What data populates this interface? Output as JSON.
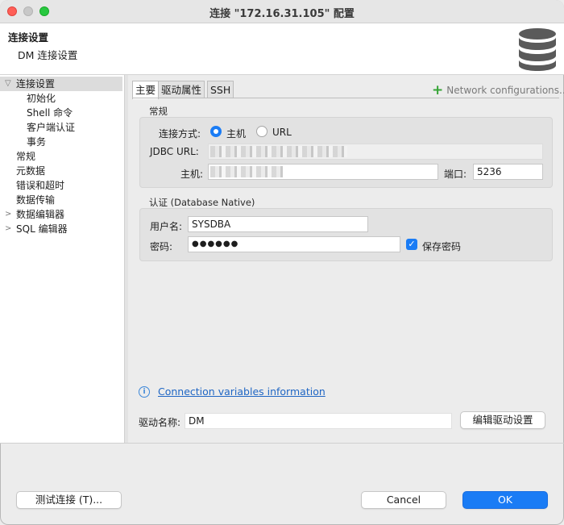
{
  "window": {
    "title": "连接 \"172.16.31.105\" 配置"
  },
  "header": {
    "title": "连接设置",
    "subtitle": "DM 连接设置",
    "icon": "database-icon"
  },
  "nav": {
    "items": [
      {
        "label": "连接设置",
        "selected": true,
        "expanded": true
      },
      {
        "label": "初始化"
      },
      {
        "label": "Shell 命令"
      },
      {
        "label": "客户端认证"
      },
      {
        "label": "事务"
      },
      {
        "label": "常规"
      },
      {
        "label": "元数据"
      },
      {
        "label": "错误和超时"
      },
      {
        "label": "数据传输"
      },
      {
        "label": "数据编辑器",
        "collapsed": true
      },
      {
        "label": "SQL 编辑器",
        "collapsed": true
      }
    ]
  },
  "tabs": [
    {
      "label": "主要",
      "active": true
    },
    {
      "label": "驱动属性"
    },
    {
      "label": "SSH"
    }
  ],
  "network": {
    "label": "Network configurations..."
  },
  "general": {
    "title": "常规",
    "connect_by_label": "连接方式:",
    "option_host": "主机",
    "option_url": "URL",
    "jdbc_label": "JDBC URL:",
    "host_label": "主机:",
    "port_label": "端口:",
    "port_value": "5236"
  },
  "auth": {
    "title": "认证 (Database Native)",
    "user_label": "用户名:",
    "user_value": "SYSDBA",
    "password_label": "密码:",
    "password_value": "●●●●●●",
    "save_password": "保存密码"
  },
  "info": {
    "link": "Connection variables information"
  },
  "driver": {
    "label": "驱动名称:",
    "value": "DM",
    "edit_button": "编辑驱动设置"
  },
  "footer": {
    "test_button": "测试连接 (T)...",
    "cancel_button": "Cancel",
    "ok_button": "OK"
  },
  "colors": {
    "accent": "#1a7cf5",
    "link": "#1f66c4",
    "add": "#36a436"
  }
}
